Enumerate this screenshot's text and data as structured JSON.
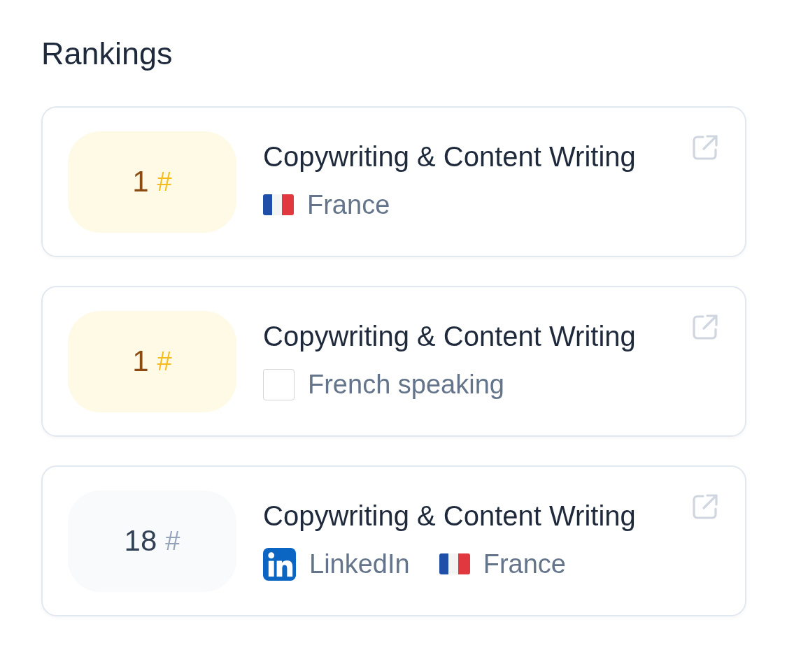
{
  "title": "Rankings",
  "rankings": [
    {
      "highlighted": true,
      "rank": "1",
      "symbol": "#",
      "category": "Copywriting & Content Writing",
      "tags": [
        {
          "kind": "flag",
          "label": "France"
        }
      ]
    },
    {
      "highlighted": true,
      "rank": "1",
      "symbol": "#",
      "category": "Copywriting & Content Writing",
      "tags": [
        {
          "kind": "blank",
          "label": "French speaking"
        }
      ]
    },
    {
      "highlighted": false,
      "rank": "18",
      "symbol": "#",
      "category": "Copywriting & Content Writing",
      "tags": [
        {
          "kind": "linkedin",
          "label": "LinkedIn"
        },
        {
          "kind": "flag",
          "label": "France"
        }
      ]
    }
  ]
}
